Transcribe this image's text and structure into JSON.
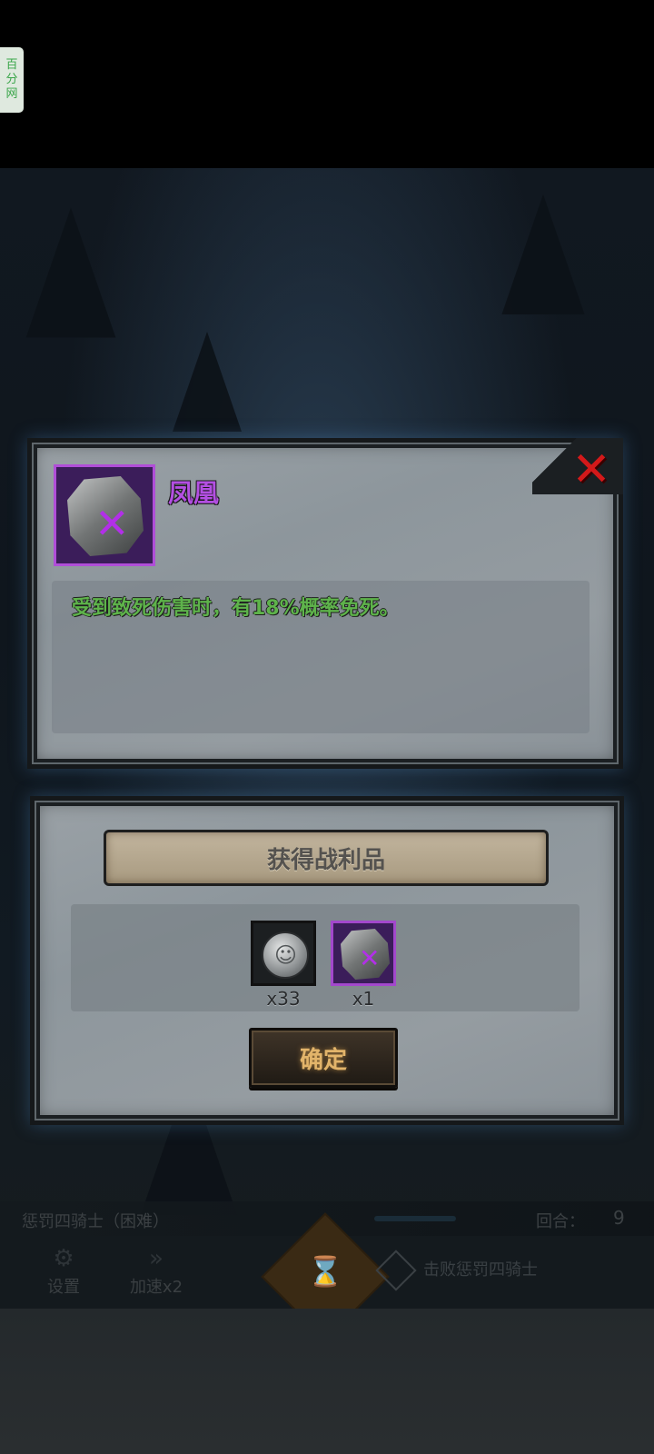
{
  "side_tag": [
    "百",
    "分",
    "网"
  ],
  "item_popup": {
    "name": "凤凰",
    "description": "受到致死伤害时，有18%概率免死。",
    "close_icon": "close-x-icon",
    "item_icon": "rune-stone-purple-icon"
  },
  "loot_popup": {
    "title": "获得战利品",
    "rewards": [
      {
        "icon": "silver-coin-icon",
        "count": "x33"
      },
      {
        "icon": "rune-stone-purple-icon",
        "count": "x1"
      }
    ],
    "confirm_label": "确定"
  },
  "status": {
    "boss_name": "惩罚四骑士（困难）",
    "round_label": "回合：",
    "round_value": "9"
  },
  "controls": {
    "settings_label": "设置",
    "speed_label": "加速x2",
    "goal_label": "击败惩罚四骑士"
  },
  "colors": {
    "rarity_purple": "#b04ed8",
    "desc_green": "#5eb34b",
    "close_red": "#d4191a",
    "confirm_gold": "#e2b46a"
  }
}
